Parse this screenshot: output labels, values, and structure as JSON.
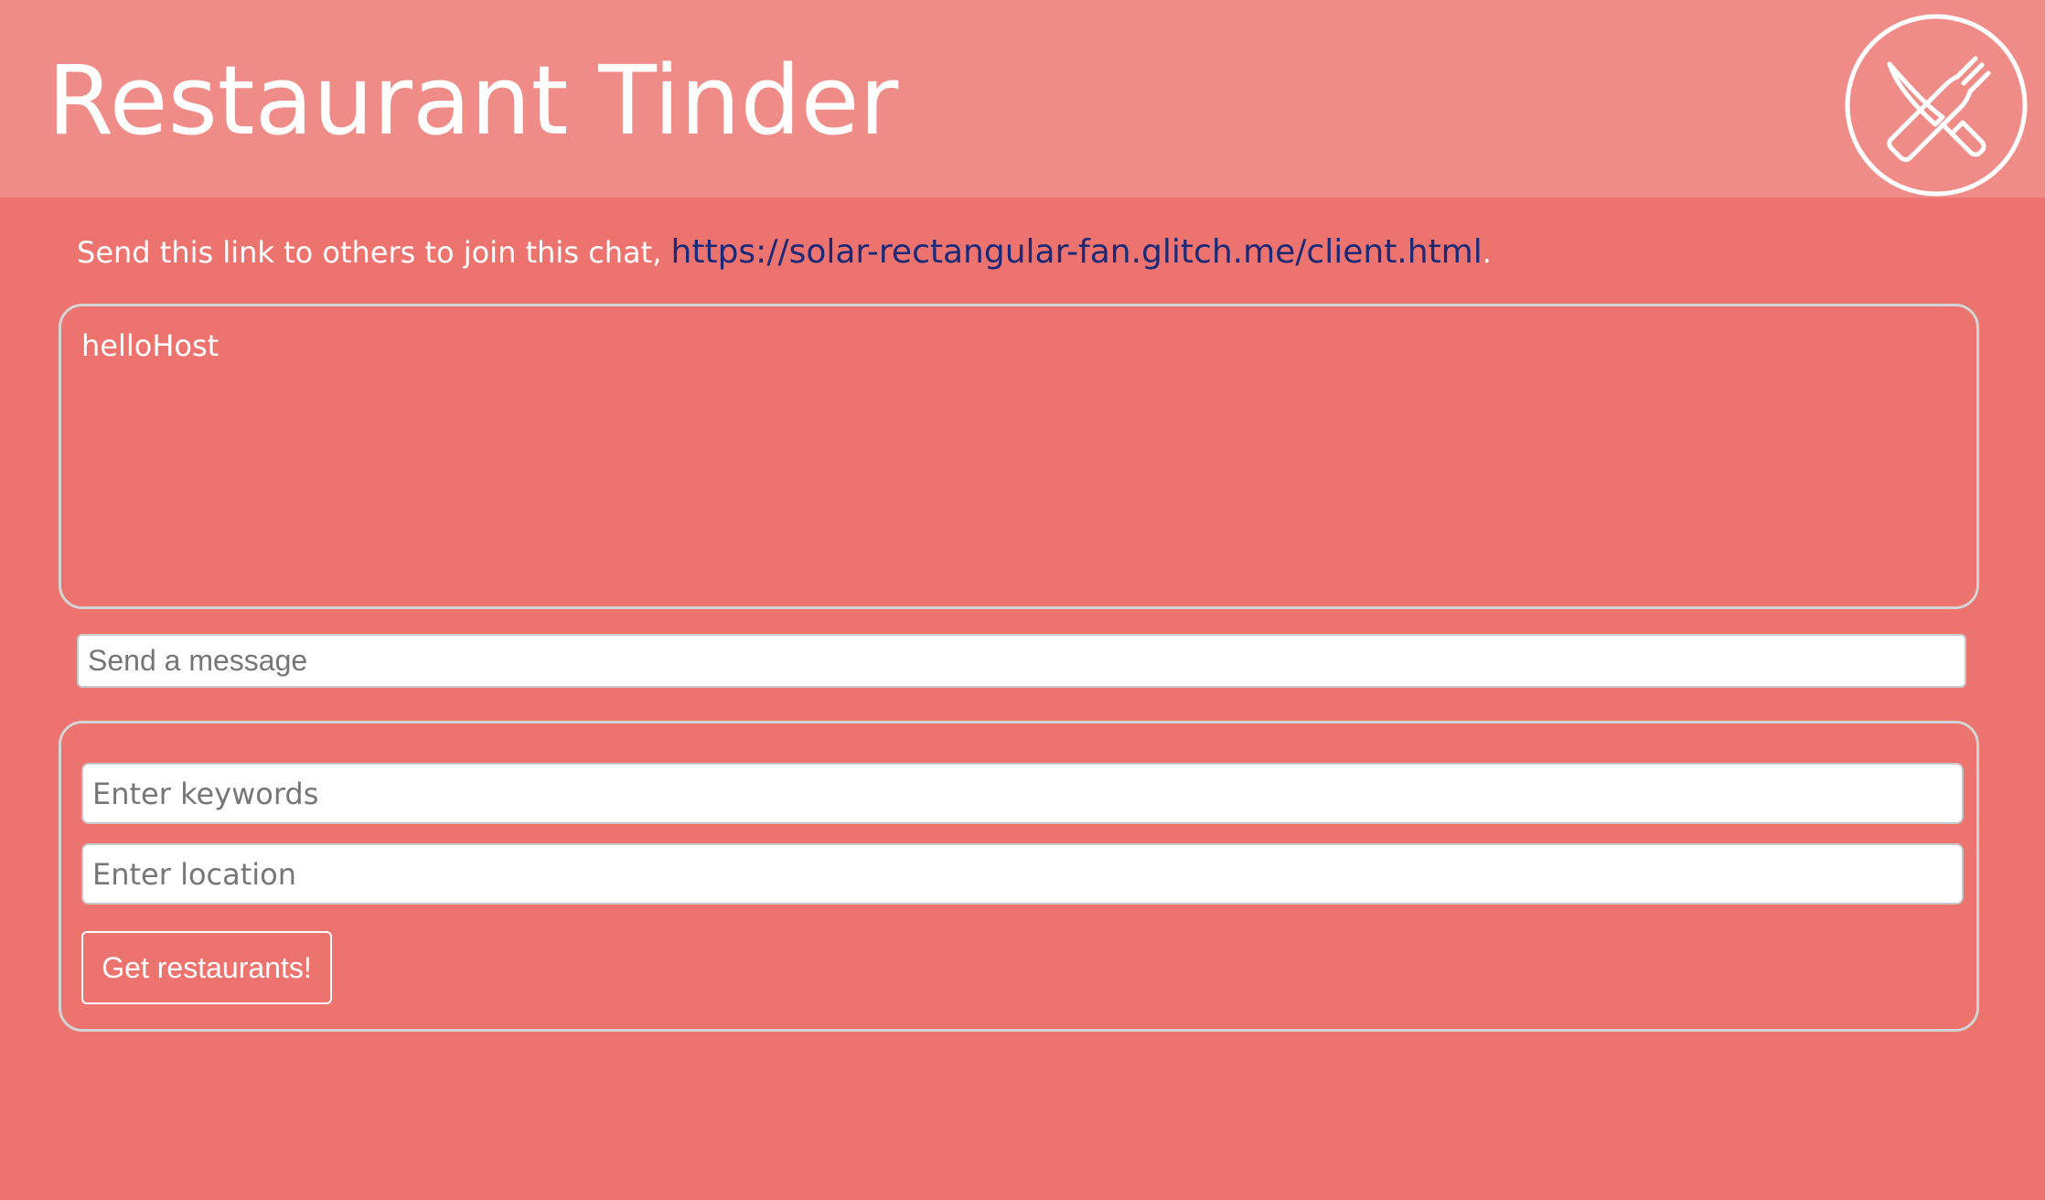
{
  "header": {
    "title": "Restaurant Tinder",
    "logo_icon": "fork-knife-icon",
    "logo_color": "#ffffff"
  },
  "share": {
    "text": "Send this link to others to join this chat, ",
    "link": "https://solar-rectangular-fan.glitch.me/client.html",
    "suffix": "."
  },
  "chat": {
    "messages": [
      "helloHost"
    ],
    "input_placeholder": "Send a message",
    "input_value": ""
  },
  "search": {
    "keywords_placeholder": "Enter keywords",
    "keywords_value": "",
    "location_placeholder": "Enter location",
    "location_value": "",
    "button_label": "Get restaurants!"
  },
  "colors": {
    "background": "#ec736e",
    "header": "#f08c87",
    "link": "#1a2a78",
    "border": "#d4d4d4"
  }
}
